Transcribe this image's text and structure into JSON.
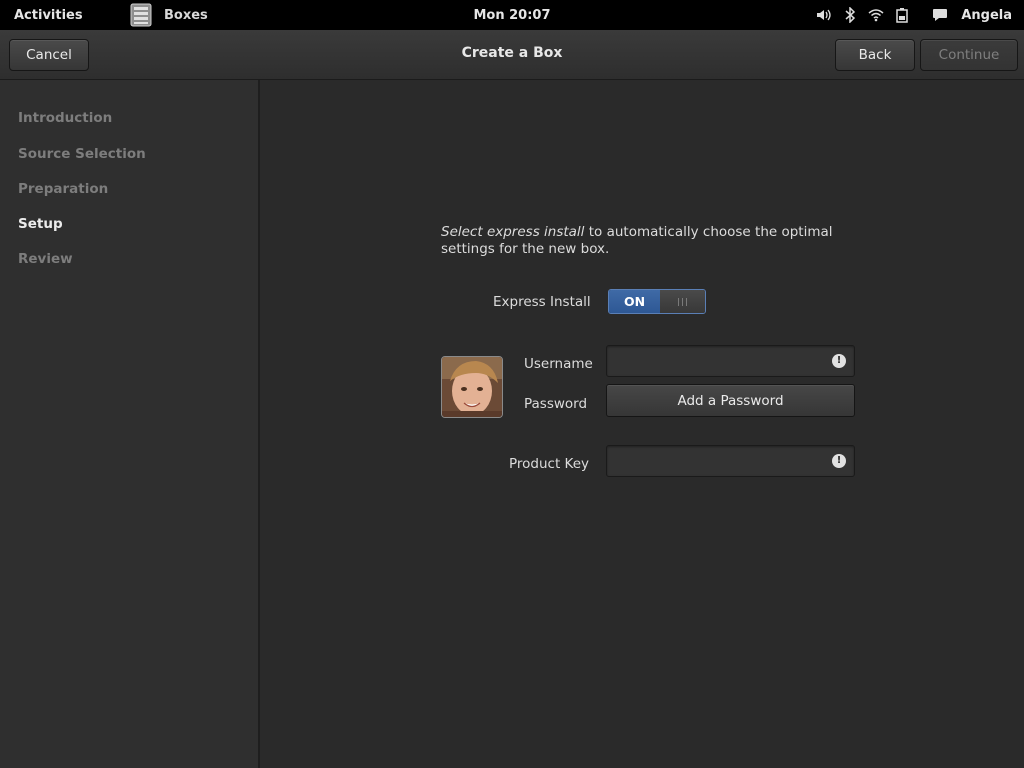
{
  "topbar": {
    "activities": "Activities",
    "app_name": "Boxes",
    "clock": "Mon 20:07",
    "user": "Angela",
    "tray_icons": [
      "volume-icon",
      "bluetooth-icon",
      "wifi-icon",
      "battery-icon",
      "chat-icon"
    ]
  },
  "header": {
    "title": "Create a Box",
    "cancel_label": "Cancel",
    "back_label": "Back",
    "continue_label": "Continue"
  },
  "sidebar": {
    "steps": [
      {
        "label": "Introduction",
        "active": false
      },
      {
        "label": "Source Selection",
        "active": false
      },
      {
        "label": "Preparation",
        "active": false
      },
      {
        "label": "Setup",
        "active": true
      },
      {
        "label": "Review",
        "active": false
      }
    ]
  },
  "setup": {
    "intro_em": "Select express install",
    "intro_rest": " to automatically choose the optimal settings for the new box.",
    "express_label": "Express Install",
    "express_state": "ON",
    "username_label": "Username",
    "username_value": "",
    "password_label": "Password",
    "password_button": "Add a Password",
    "product_key_label": "Product Key",
    "product_key_value": ""
  },
  "colors": {
    "accent": "#3f6aa6",
    "background": "#2a2a2a",
    "sidebar": "#2f2f2f",
    "topbar": "#000000"
  }
}
